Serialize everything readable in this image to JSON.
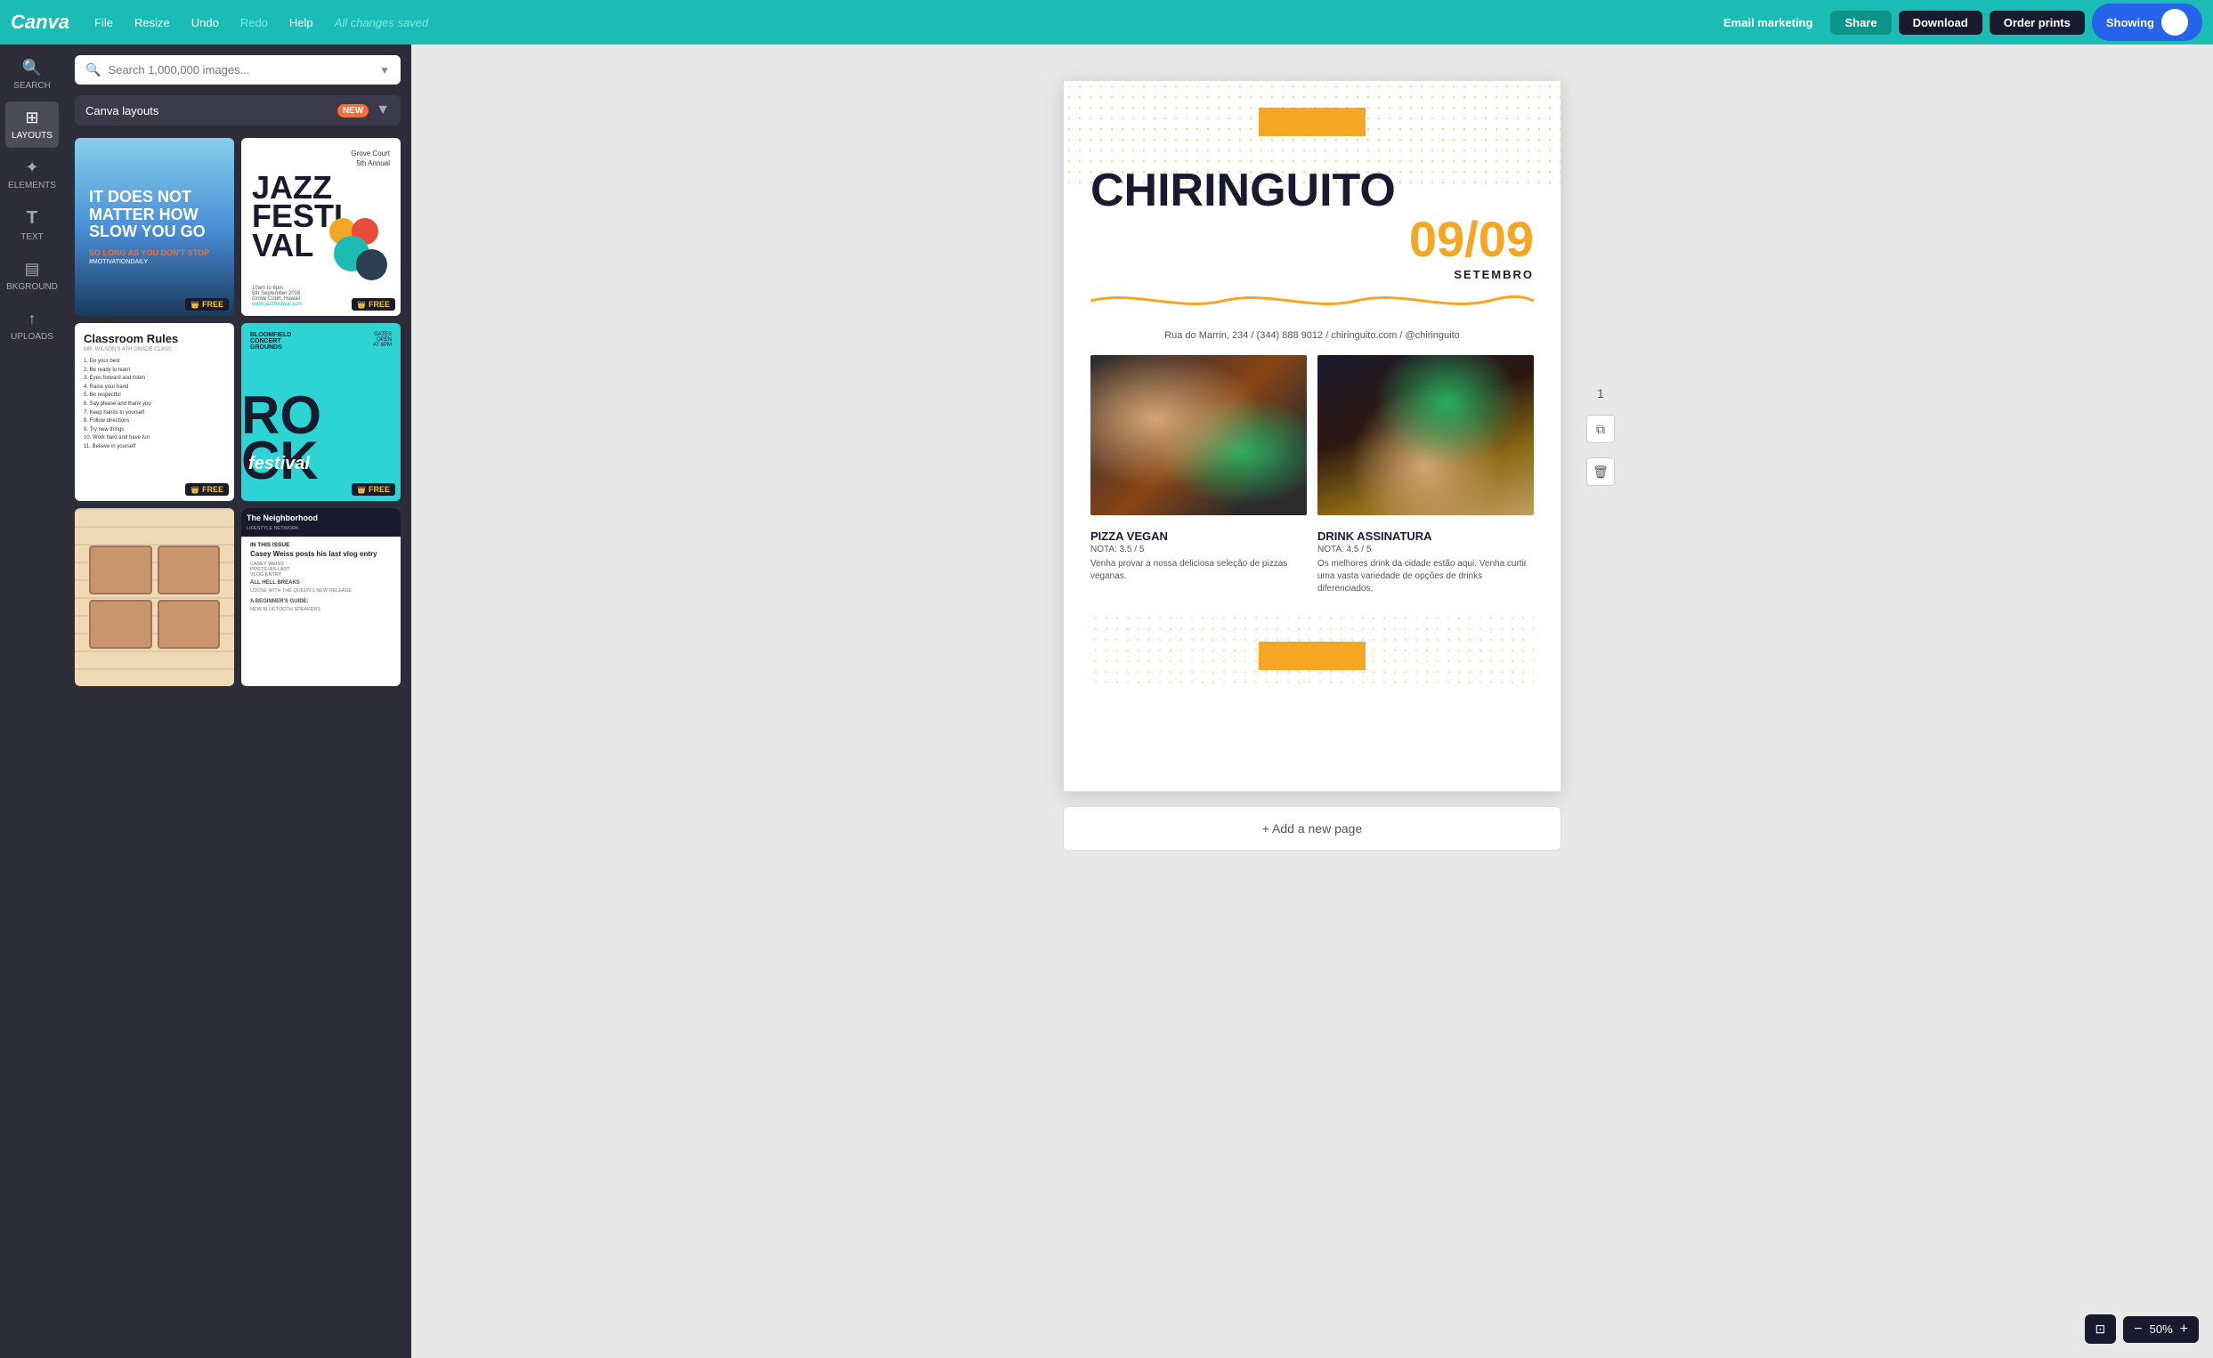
{
  "topnav": {
    "logo": "Canva",
    "file_label": "File",
    "resize_label": "Resize",
    "undo_label": "Undo",
    "redo_label": "Redo",
    "help_label": "Help",
    "all_changes": "All changes saved",
    "email_marketing": "Email marketing",
    "share": "Share",
    "download": "Download",
    "order_prints": "Order prints",
    "showing": "Showing"
  },
  "sidebar": {
    "items": [
      {
        "icon": "🔍",
        "label": "SEARCH",
        "active": false
      },
      {
        "icon": "⊞",
        "label": "LAYOUTS",
        "active": true
      },
      {
        "icon": "✦",
        "label": "ELEMENTS",
        "active": false
      },
      {
        "icon": "T",
        "label": "TEXT",
        "active": false
      },
      {
        "icon": "▤",
        "label": "BKGROUND",
        "active": false
      },
      {
        "icon": "↑",
        "label": "UPLOADS",
        "active": false
      }
    ]
  },
  "panel": {
    "search_placeholder": "Search 1,000,000 images...",
    "filter_label": "Canva layouts",
    "filter_badge": "NEW",
    "templates": [
      {
        "id": "motivational",
        "type": "motivational"
      },
      {
        "id": "jazz",
        "type": "jazz"
      },
      {
        "id": "classroom",
        "type": "classroom"
      },
      {
        "id": "rock",
        "type": "rock"
      },
      {
        "id": "cassette",
        "type": "cassette"
      },
      {
        "id": "neighborhood",
        "type": "neighborhood"
      }
    ]
  },
  "canvas": {
    "date": "09/09",
    "title": "CHIRINGUITO",
    "subtitle": "SETEMBRO",
    "contact": "Rua do Marrin, 234 / (344) 888 9012 / chiringuito.com / @chiringuito",
    "item1": {
      "title": "PIZZA VEGAN",
      "rating": "NOTA: 3.5 / 5",
      "desc": "Venha provar a nossa deliciosa seleção de pizzas veganas."
    },
    "item2": {
      "title": "DRINK ASSINATURA",
      "rating": "NOTA: 4.5 / 5",
      "desc": "Os melhores drink da cidade estão aqui. Venha curtir uma vasta variedade de opções de drinks diferenciados."
    }
  },
  "add_page_label": "+ Add a new page",
  "bottom": {
    "present_icon": "⊡",
    "zoom_minus": "−",
    "zoom_level": "50%",
    "zoom_plus": "+"
  },
  "classroom": {
    "title": "Classroom Rules",
    "subtitle": "MR. WILSON'S 4TH GRADE CLASS",
    "rules": [
      "1. Do your best",
      "2. Be ready to learn",
      "3. Eyes forward and listen",
      "4. Raise your hand",
      "5. Be respectful",
      "6. Say please and thank you",
      "7. Keep hands to yourself",
      "8. Follow directions",
      "9. Try new things",
      "10. Work hard and have fun",
      "11. Believe in yourself"
    ]
  }
}
